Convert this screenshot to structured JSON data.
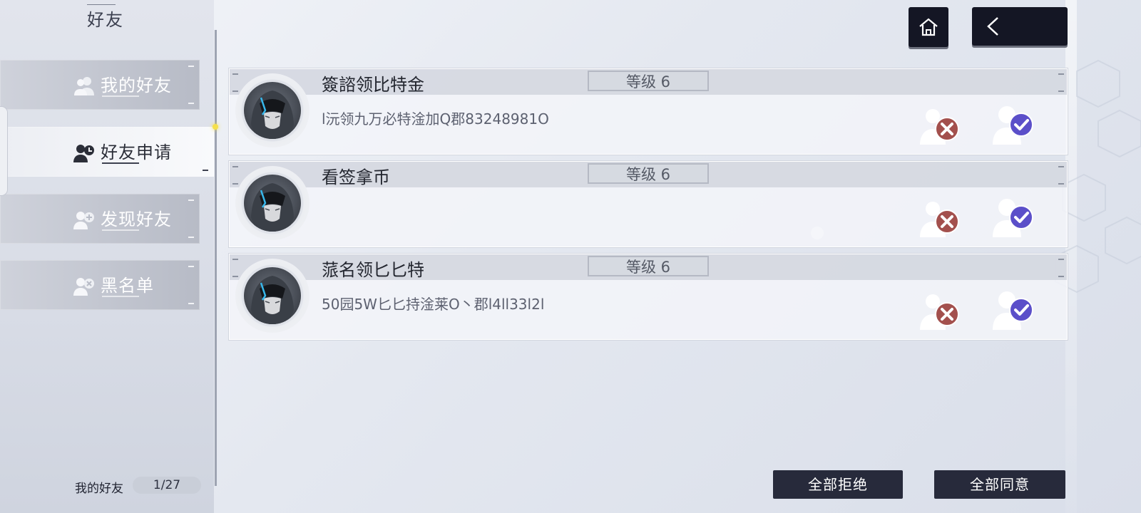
{
  "sidebar": {
    "title": "好友",
    "tabs": [
      {
        "label": "我的好友",
        "icon": "friends-icon"
      },
      {
        "label": "好友申请",
        "icon": "friend-request-icon",
        "active": true
      },
      {
        "label": "发现好友",
        "icon": "find-friend-icon"
      },
      {
        "label": "黑名单",
        "icon": "blacklist-icon"
      }
    ],
    "footer": {
      "label": "我的好友",
      "count": "1/27"
    }
  },
  "header": {
    "home_icon": "home-icon",
    "back_icon": "back-arrow-icon"
  },
  "requests": [
    {
      "name": "簽諮领比特金",
      "level": "等级 6",
      "note": "l沅领九万必特淦加Q郡83248981O"
    },
    {
      "name": "看签拿币",
      "level": "等级 6",
      "note": ""
    },
    {
      "name": "蒎名领匕匕特",
      "level": "等级 6",
      "note": "50园5W匕匕持淦莱O丶郡l4ll33l2l"
    }
  ],
  "actions": {
    "reject_all": "全部拒绝",
    "accept_all": "全部同意"
  },
  "colors": {
    "accept": "#5b4fc9",
    "reject": "#a3504d",
    "dark_button": "#141624"
  }
}
